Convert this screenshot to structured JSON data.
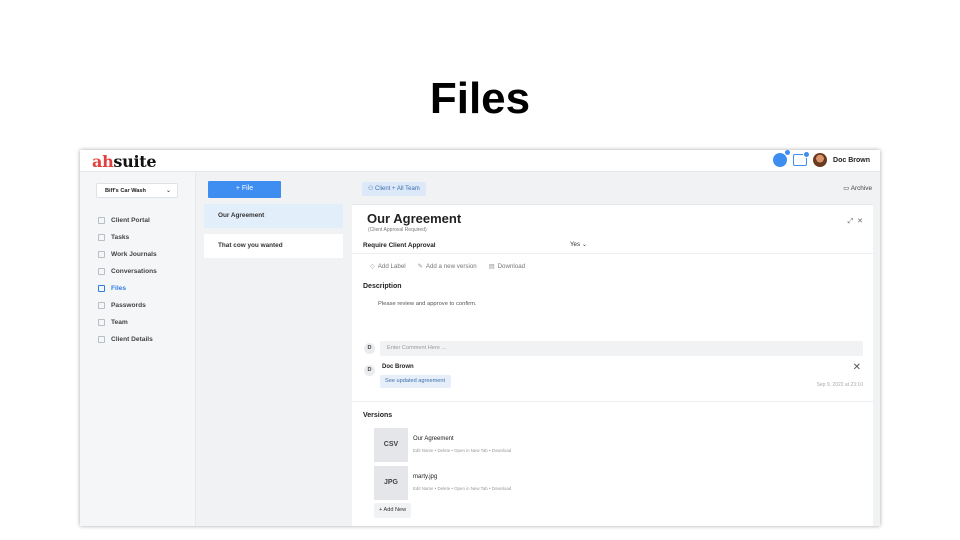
{
  "slide": {
    "title": "Files"
  },
  "topbar": {
    "logo_mark": "ah",
    "logo_text": "suite",
    "user_name": "Doc Brown"
  },
  "sidebar": {
    "account": "Biff's Car Wash",
    "items": [
      {
        "label": "Client Portal",
        "active": false
      },
      {
        "label": "Tasks",
        "active": false
      },
      {
        "label": "Work Journals",
        "active": false
      },
      {
        "label": "Conversations",
        "active": false
      },
      {
        "label": "Files",
        "active": true
      },
      {
        "label": "Passwords",
        "active": false
      },
      {
        "label": "Team",
        "active": false
      },
      {
        "label": "Client Details",
        "active": false
      }
    ]
  },
  "filelist": {
    "add_label": "+ File",
    "files": [
      {
        "name": "Our Agreement"
      },
      {
        "name": "That cow you wanted"
      }
    ]
  },
  "main": {
    "audience": "Client + All Team",
    "archive": "Archive",
    "title": "Our Agreement",
    "subtitle": "(Client Approval Required)",
    "approval_label": "Require Client Approval",
    "approval_value": "Yes",
    "actions": {
      "label": "Add Label",
      "version": "Add a new version",
      "download": "Download"
    },
    "description_heading": "Description",
    "description_text": "Please review and approve to confirm.",
    "comment_placeholder": "Enter Comment Here ...",
    "comment": {
      "initial": "D",
      "author": "Doc Brown",
      "text": "See updated agreement",
      "date": "Sep 9, 2022 at 23:10"
    },
    "versions_heading": "Versions",
    "versions": [
      {
        "type": "CSV",
        "name": "Our Agreement",
        "links": "Edit Name  •  Delete  •  Open in New Tab  •  Download"
      },
      {
        "type": "JPG",
        "name": "marty.jpg",
        "links": "Edit Name  •  Delete  •  Open in New Tab  •  Download"
      }
    ],
    "add_new": "+ Add New"
  }
}
